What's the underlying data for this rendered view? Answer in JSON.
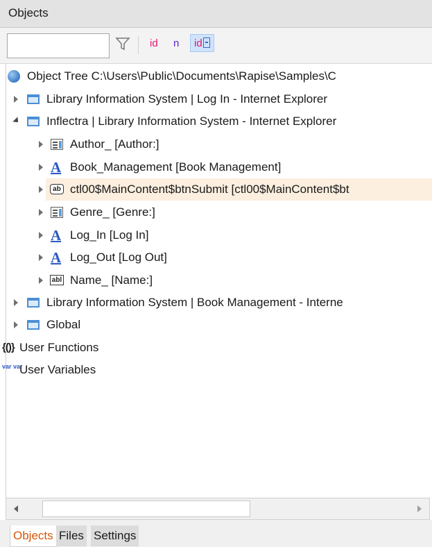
{
  "panel": {
    "title": "Objects"
  },
  "toolbar": {
    "search_value": "",
    "buttons": [
      {
        "label": "id"
      },
      {
        "label": "n"
      },
      {
        "label": "id"
      }
    ]
  },
  "tree": {
    "root": "Object Tree C:\\Users\\Public\\Documents\\Rapise\\Samples\\C",
    "nodes": [
      {
        "label": "Library Information System | Log In - Internet Explorer",
        "icon": "window-icon",
        "expanded": false
      },
      {
        "label": "Inflectra | Library Information System - Internet Explorer",
        "icon": "window-icon",
        "expanded": true,
        "children": [
          {
            "label": "Author_ [Author:]",
            "icon": "listbox-icon"
          },
          {
            "label": "Book_Management [Book Management]",
            "icon": "link-icon"
          },
          {
            "label": "ctl00$MainContent$btnSubmit [ctl00$MainContent$bt",
            "icon": "button-icon",
            "selected": true
          },
          {
            "label": "Genre_ [Genre:]",
            "icon": "listbox-icon"
          },
          {
            "label": "Log_In [Log In]",
            "icon": "link-icon"
          },
          {
            "label": "Log_Out [Log Out]",
            "icon": "link-icon"
          },
          {
            "label": "Name_ [Name:]",
            "icon": "textbox-icon"
          }
        ]
      },
      {
        "label": "Library Information System | Book Management - Interne",
        "icon": "window-icon",
        "expanded": false
      },
      {
        "label": "Global",
        "icon": "window-icon",
        "expanded": false
      }
    ],
    "user_functions": "User Functions",
    "user_variables": "User Variables"
  },
  "icons": {
    "link_glyph": "A",
    "button_glyph": "ab",
    "textbox_glyph": "abl",
    "function_glyph": "{()}",
    "variable_glyph": "var var"
  },
  "tabs": [
    {
      "label": "Objects",
      "active": true
    },
    {
      "label": "Files",
      "active": false
    },
    {
      "label": "Settings",
      "active": false
    }
  ],
  "colors": {
    "accent_tab": "#d4570a",
    "selection": "#fcefdf",
    "link_icon": "#2c59c4",
    "id_button": "#e8126f",
    "n_button": "#5a1fc9"
  }
}
